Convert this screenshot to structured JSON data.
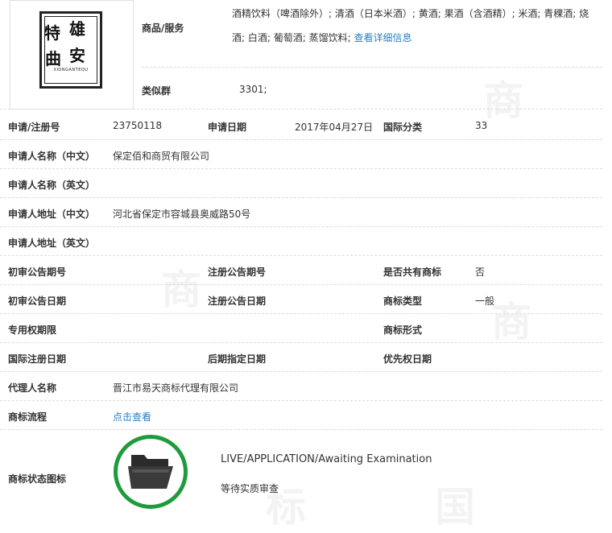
{
  "header": {
    "logo": {
      "chars": [
        "特",
        "雄",
        "曲",
        "安"
      ],
      "subtext": "XIONGANTEQU"
    },
    "goods_label": "商品/服务",
    "goods_line1": "酒精饮料（啤酒除外）; 清酒（日本米酒）; 黄酒; 果酒（含酒精）; 米酒; 青稞酒; 烧",
    "goods_line2": "酒; 白酒; 葡萄酒; 蒸馏饮料; ",
    "goods_link": "查看详细信息",
    "similar_label": "类似群",
    "similar_value": "3301;"
  },
  "fields": {
    "reg_no_label": "申请/注册号",
    "reg_no": "23750118",
    "app_date_label": "申请日期",
    "app_date": "2017年04月27日",
    "intl_class_label": "国际分类",
    "intl_class": "33",
    "name_cn_label": "申请人名称（中文）",
    "name_cn": "保定佰和商贸有限公司",
    "name_en_label": "申请人名称（英文）",
    "addr_cn_label": "申请人地址（中文）",
    "addr_cn": "河北省保定市容城县奥威路50号",
    "addr_en_label": "申请人地址（英文）",
    "prelim_no_label": "初审公告期号",
    "reg_pub_no_label": "注册公告期号",
    "shared_label": "是否共有商标",
    "shared": "否",
    "prelim_date_label": "初审公告日期",
    "reg_pub_date_label": "注册公告日期",
    "mark_type_label": "商标类型",
    "mark_type": "一般",
    "exclusive_label": "专用权期限",
    "mark_form_label": "商标形式",
    "intl_reg_date_label": "国际注册日期",
    "later_date_label": "后期指定日期",
    "priority_date_label": "优先权日期",
    "agent_label": "代理人名称",
    "agent": "晋江市易天商标代理有限公司",
    "flow_label": "商标流程",
    "flow_link": "点击查看",
    "status_icon_label": "商标状态图标",
    "status_en": "LIVE/APPLICATION/Awaiting Examination",
    "status_cn": "等待实质审查"
  },
  "colors": {
    "link": "#2a7fc4",
    "status_ring": "#1e9b3c"
  },
  "icons": {
    "status": "folder-icon"
  }
}
